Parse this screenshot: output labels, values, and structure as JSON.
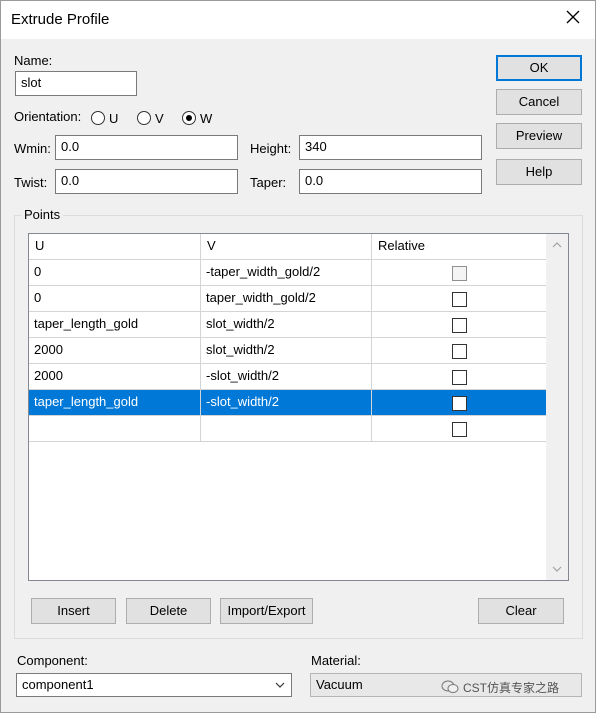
{
  "window": {
    "title": "Extrude Profile"
  },
  "form": {
    "name_label": "Name:",
    "name_value": "slot",
    "orientation_label": "Orientation:",
    "orientation_options": [
      "U",
      "V",
      "W"
    ],
    "orientation_selected": "W",
    "wmin_label": "Wmin:",
    "wmin_value": "0.0",
    "height_label": "Height:",
    "height_value": "340",
    "twist_label": "Twist:",
    "twist_value": "0.0",
    "taper_label": "Taper:",
    "taper_value": "0.0"
  },
  "buttons": {
    "ok": "OK",
    "cancel": "Cancel",
    "preview": "Preview",
    "help": "Help",
    "insert": "Insert",
    "delete": "Delete",
    "import_export": "Import/Export",
    "clear": "Clear"
  },
  "points": {
    "group_title": "Points",
    "columns": [
      "U",
      "V",
      "Relative"
    ],
    "rows": [
      {
        "u": "0",
        "v": "-taper_width_gold/2",
        "relative": false,
        "relative_enabled": false,
        "selected": false
      },
      {
        "u": "0",
        "v": "taper_width_gold/2",
        "relative": false,
        "relative_enabled": true,
        "selected": false
      },
      {
        "u": "taper_length_gold",
        "v": "slot_width/2",
        "relative": false,
        "relative_enabled": true,
        "selected": false
      },
      {
        "u": "2000",
        "v": "slot_width/2",
        "relative": false,
        "relative_enabled": true,
        "selected": false
      },
      {
        "u": "2000",
        "v": "-slot_width/2",
        "relative": false,
        "relative_enabled": true,
        "selected": false
      },
      {
        "u": "taper_length_gold",
        "v": "-slot_width/2",
        "relative": false,
        "relative_enabled": true,
        "selected": true
      },
      {
        "u": "",
        "v": "",
        "relative": false,
        "relative_enabled": true,
        "selected": false
      }
    ]
  },
  "component": {
    "label": "Component:",
    "value": "component1"
  },
  "material": {
    "label": "Material:",
    "value": "Vacuum"
  },
  "watermark": {
    "text": "CST仿真专家之路"
  },
  "icons": {
    "close": "close-icon",
    "scroll_up": "chevron-up-icon",
    "scroll_down": "chevron-down-icon",
    "dropdown": "chevron-down-icon",
    "watermark": "wechat-icon"
  },
  "colors": {
    "accent": "#0078d7",
    "selection": "#0078d7"
  }
}
